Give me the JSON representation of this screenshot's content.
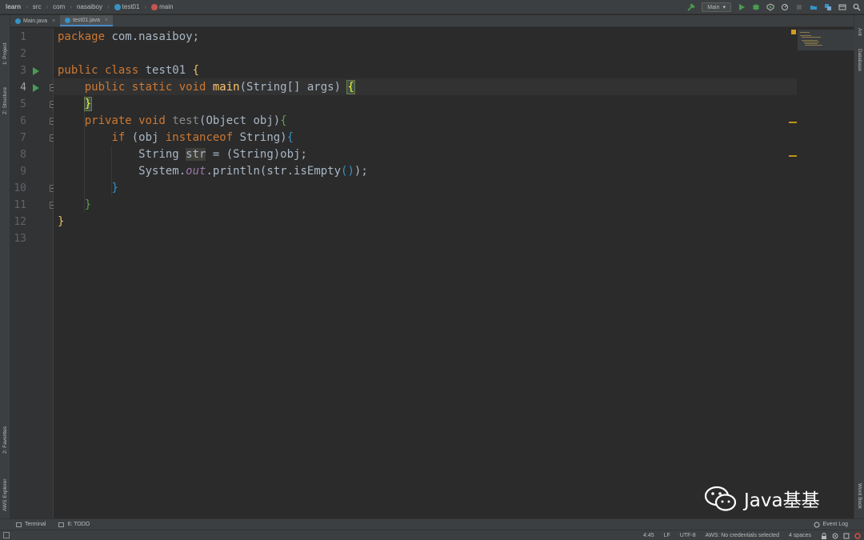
{
  "breadcrumbs": [
    "learn",
    "src",
    "com",
    "nasaiboy",
    "test01",
    "main"
  ],
  "toolbar": {
    "run_config": "Main"
  },
  "tabs": [
    {
      "label": "Main.java",
      "active": false
    },
    {
      "label": "test01.java",
      "active": true
    }
  ],
  "left_stripe": {
    "project": "1: Project",
    "structure": "Z: Structure",
    "favorites": "2: Favorites",
    "aws_explorer": "AWS Explorer"
  },
  "right_stripe": {
    "ant": "Ant",
    "database": "Database",
    "word_book": "Word Book"
  },
  "editor": {
    "line_numbers": [
      "1",
      "2",
      "3",
      "4",
      "5",
      "6",
      "7",
      "8",
      "9",
      "10",
      "11",
      "12",
      "13"
    ],
    "current_line": "4",
    "code": {
      "l1_kw": "package",
      "l1_rest": " com.nasaiboy;",
      "l3_kw": "public class",
      "l3_name": " test01 ",
      "l3_brace": "{",
      "l4_kw": "public static void",
      "l4_fn": "main",
      "l4_args": "(String[] args) ",
      "l4_brace": "{",
      "l5_brace": "}",
      "l6_kw": "private void",
      "l6_fn": "test",
      "l6_args": "(Object obj)",
      "l6_brace": "{",
      "l7_kw": "if",
      "l7_open": " (obj ",
      "l7_kw2": "instanceof",
      "l7_rest": " String)",
      "l7_brace": "{",
      "l8_type": "String ",
      "l8_var": "str",
      "l8_rest": " = (String)obj;",
      "l9_a": "System.",
      "l9_out": "out",
      "l9_b": ".println(str.isEmpty",
      "l9_paren": "()",
      "l9_c": ");",
      "l10_brace": "}",
      "l11_brace": "}",
      "l12_brace": "}"
    }
  },
  "bottom_tools": {
    "terminal": "Terminal",
    "todo": "6: TODO",
    "event_log": "Event Log"
  },
  "status": {
    "position": "4:45",
    "line_sep": "LF",
    "encoding": "UTF-8",
    "aws": "AWS: No credentials selected",
    "indent": "4 spaces"
  },
  "watermark": "Java基基",
  "colors": {
    "keyword": "#cc7832",
    "function": "#ffc66d",
    "text": "#a9b7c6",
    "run": "#499c54"
  }
}
